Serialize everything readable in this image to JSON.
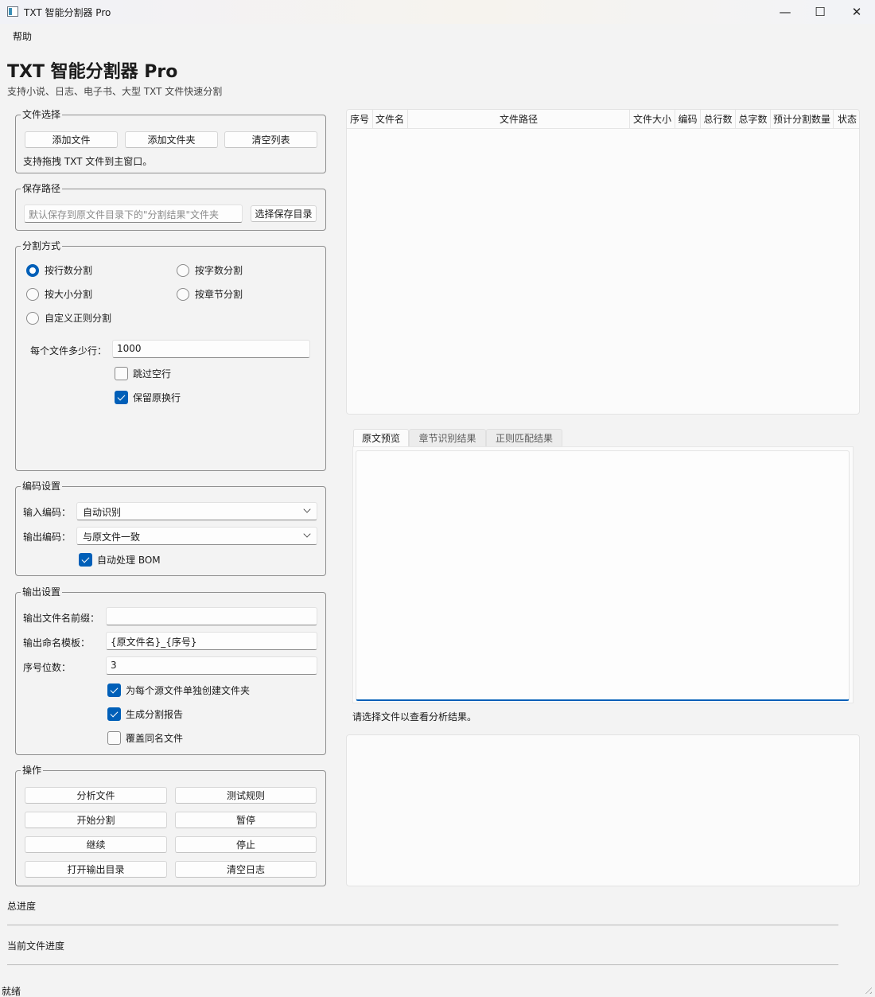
{
  "window": {
    "title": "TXT 智能分割器 Pro",
    "minimize_glyph": "—",
    "maximize_glyph": "☐",
    "close_glyph": "✕"
  },
  "menu": {
    "help": "帮助"
  },
  "header": {
    "title": "TXT 智能分割器 Pro",
    "subtitle": "支持小说、日志、电子书、大型 TXT 文件快速分割"
  },
  "file_select": {
    "title": "文件选择",
    "add_file": "添加文件",
    "add_folder": "添加文件夹",
    "clear_list": "清空列表",
    "hint": "支持拖拽 TXT 文件到主窗口。"
  },
  "save_path": {
    "title": "保存路径",
    "placeholder": "默认保存到原文件目录下的\"分割结果\"文件夹",
    "choose_button": "选择保存目录"
  },
  "split_mode": {
    "title": "分割方式",
    "options": [
      "按行数分割",
      "按字数分割",
      "按大小分割",
      "按章节分割",
      "自定义正则分割"
    ],
    "selected": "按行数分割",
    "lines_label": "每个文件多少行：",
    "lines_value": "1000",
    "skip_empty": "跳过空行",
    "keep_linebreak": "保留原换行"
  },
  "encoding": {
    "title": "编码设置",
    "input_label": "输入编码：",
    "input_value": "自动识别",
    "output_label": "输出编码：",
    "output_value": "与原文件一致",
    "auto_bom": "自动处理 BOM"
  },
  "output": {
    "title": "输出设置",
    "prefix_label": "输出文件名前缀：",
    "prefix_value": "",
    "template_label": "输出命名模板：",
    "template_value": "{原文件名}_{序号}",
    "digits_label": "序号位数：",
    "digits_value": "3",
    "folder_per_file": "为每个源文件单独创建文件夹",
    "gen_report": "生成分割报告",
    "overwrite": "覆盖同名文件"
  },
  "actions": {
    "title": "操作",
    "analyze": "分析文件",
    "test_rule": "测试规则",
    "start": "开始分割",
    "pause": "暂停",
    "resume": "继续",
    "stop": "停止",
    "open_output": "打开输出目录",
    "clear_log": "清空日志"
  },
  "table": {
    "columns": [
      "序号",
      "文件名",
      "文件路径",
      "文件大小",
      "编码",
      "总行数",
      "总字数",
      "预计分割数量",
      "状态"
    ]
  },
  "preview": {
    "tabs": [
      "原文预览",
      "章节识别结果",
      "正则匹配结果"
    ],
    "active_tab": "原文预览",
    "status": "请选择文件以查看分析结果。"
  },
  "progress": {
    "total_label": "总进度",
    "total_value": 0,
    "current_label": "当前文件进度",
    "current_value": 0
  },
  "statusbar": {
    "text": "就绪"
  },
  "colors": {
    "accent": "#005fb8",
    "background": "#f3f3f3"
  }
}
